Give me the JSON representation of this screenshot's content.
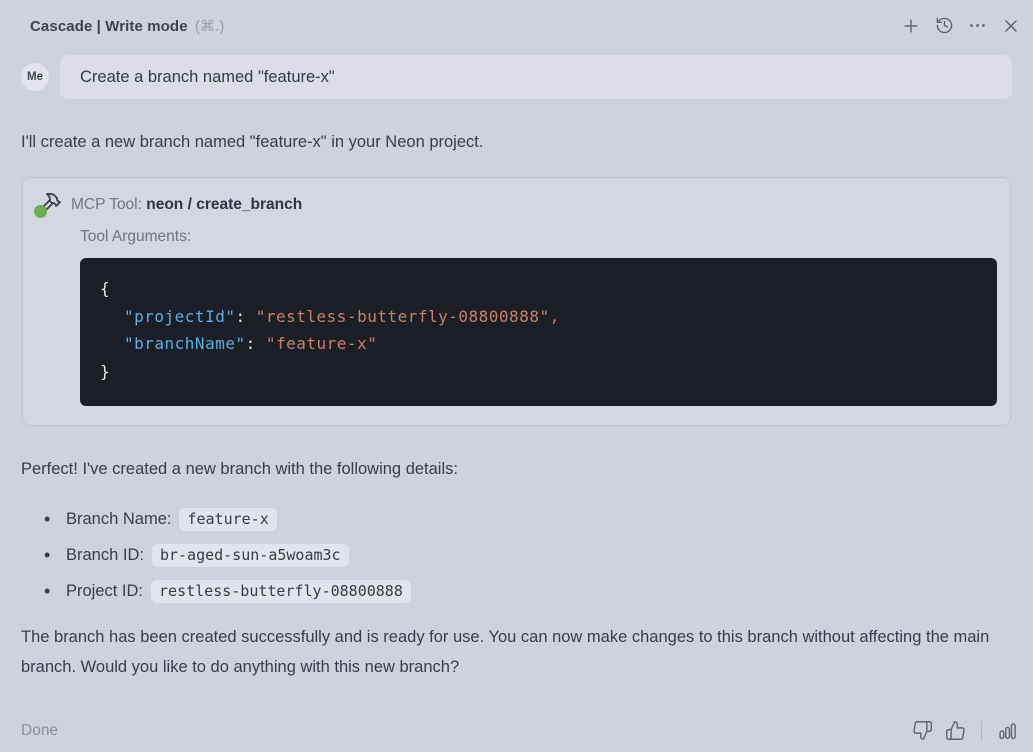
{
  "header": {
    "title": "Cascade | Write mode",
    "shortcut": "(⌘.)"
  },
  "user_message": {
    "avatar": "Me",
    "text": "Create a branch named \"feature-x\""
  },
  "assistant": {
    "intro": "I'll create a new branch named \"feature-x\" in your Neon project.",
    "tool_card": {
      "label": "MCP Tool: ",
      "tool_name": "neon / create_branch",
      "arguments_label": "Tool Arguments:",
      "code": {
        "open_brace": "{",
        "close_brace": "}",
        "lines": [
          {
            "key": "\"projectId\"",
            "colon": ": ",
            "value": "\"restless-butterfly-08800888\"",
            "comma": ","
          },
          {
            "key": "\"branchName\"",
            "colon": ": ",
            "value": "\"feature-x\"",
            "comma": ""
          }
        ]
      }
    },
    "details_intro": "Perfect! I've created a new branch with the following details:",
    "details": [
      {
        "label": "Branch Name:",
        "value": "feature-x"
      },
      {
        "label": "Branch ID:",
        "value": "br-aged-sun-a5woam3c"
      },
      {
        "label": "Project ID:",
        "value": "restless-butterfly-08800888"
      }
    ],
    "closing": "The branch has been created successfully and is ready for use. You can now make changes to this branch without affecting the main branch. Would you like to do anything with this new branch?"
  },
  "footer": {
    "status": "Done"
  },
  "icons": {
    "new_conversation": "plus-icon",
    "history": "history-clock-icon",
    "more_options": "ellipsis-icon",
    "close": "close-x-icon",
    "mcp_tool": "hammer-icon",
    "feedback_negative": "thumbs-down-icon",
    "feedback_positive": "thumbs-up-icon",
    "stats": "bar-chart-icon"
  },
  "colors": {
    "page_bg": "#cfd2da",
    "bubble_bg": "#dcdde6",
    "text_primary": "#3a4150",
    "text_muted": "#6f7583",
    "card_bg": "#d4d7df",
    "card_border": "#c1c4ce",
    "code_bg": "#1b1e24",
    "code_text": "#e9eaec",
    "code_key": "#58aee8",
    "code_string": "#c9816a",
    "inline_code_bg": "#e2e4eb",
    "status_green": "#69ae53"
  }
}
